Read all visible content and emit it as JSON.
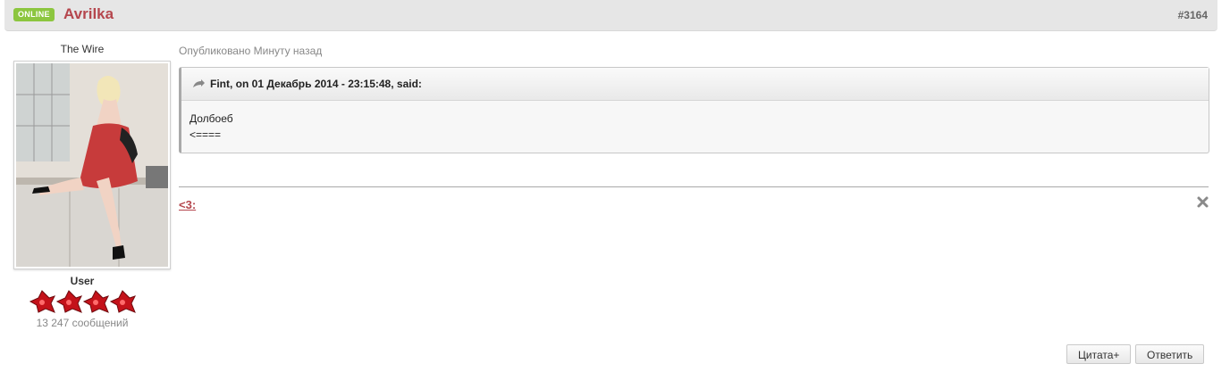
{
  "header": {
    "online_badge": "ONLINE",
    "author": "Avrilka",
    "post_number": "#3164"
  },
  "sidebar": {
    "member_title": "The Wire",
    "avatar_icon": "avatar-photo",
    "group": "User",
    "reputation_stars": 4,
    "post_count": "13 247 сообщений"
  },
  "post": {
    "posted": "Опубликовано Минуту назад",
    "quote": {
      "citation": "Fint, on 01 Декабрь 2014 - 23:15:48, said:",
      "line1": "Долбоеб",
      "line2": "<===="
    },
    "signature": "<3:"
  },
  "actions": {
    "quote_label": "Цитата+",
    "reply_label": "Ответить"
  },
  "colors": {
    "author": "#b5464d",
    "online": "#8cc63f",
    "header_bg": "#e6e6e6"
  }
}
